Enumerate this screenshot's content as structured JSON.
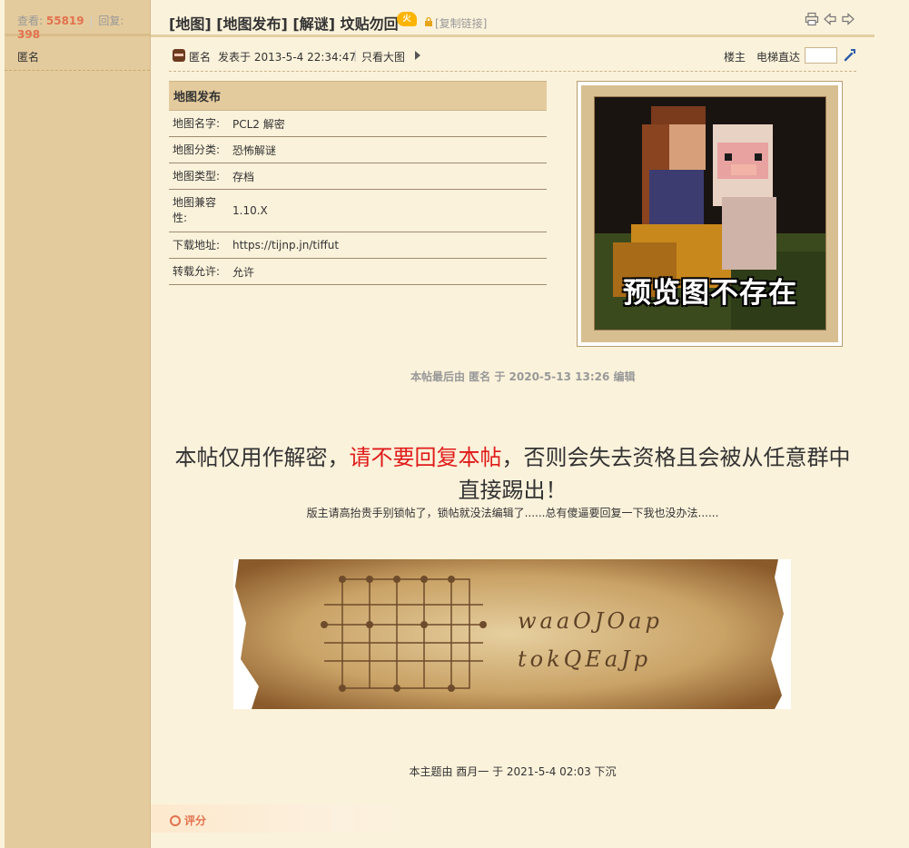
{
  "sidebar": {
    "views_label": "查看:",
    "views_value": "55819",
    "replies_label": "回复:",
    "replies_value": "398",
    "author": "匿名"
  },
  "header": {
    "title": "[地图] [地图发布] [解谜] 坟贴勿回",
    "fire_badge": "火",
    "copy_link": "[复制链接]"
  },
  "post_head": {
    "author": "匿名",
    "posted_at": "发表于 2013-5-4 22:34:47",
    "only_big_image": "只看大图",
    "floor": "楼主",
    "elevator": "电梯直达"
  },
  "info_table": {
    "heading": "地图发布",
    "rows": [
      {
        "key": "地图名字:",
        "value": "PCL2 解密"
      },
      {
        "key": "地图分类:",
        "value": "恐怖解谜"
      },
      {
        "key": "地图类型:",
        "value": "存档"
      },
      {
        "key": "地图兼容性:",
        "value": "1.10.X"
      },
      {
        "key": "下载地址:",
        "value": "https://tijnp.jn/tiffut"
      },
      {
        "key": "转载允许:",
        "value": "允许"
      }
    ]
  },
  "preview": {
    "caption": "预览图不存在"
  },
  "edit_note": "本帖最后由 匿名 于 2020-5-13 13:26 编辑",
  "notice": {
    "part1": "本帖仅用作解密，",
    "red": "请不要回复本帖",
    "part2": "，否则会失去资格且会被从任意群中直接踢出！",
    "sub": "版主请高抬贵手别锁帖了，锁帖就没法编辑了......总有傻逼要回复一下我也没办法......"
  },
  "scroll_image": {
    "line1": "waaOJOap",
    "line2": "tokQEaJp"
  },
  "bottom_note": "本主题由 酉月一 于 2021-5-4 02:03 下沉",
  "rate_label": "评分"
}
